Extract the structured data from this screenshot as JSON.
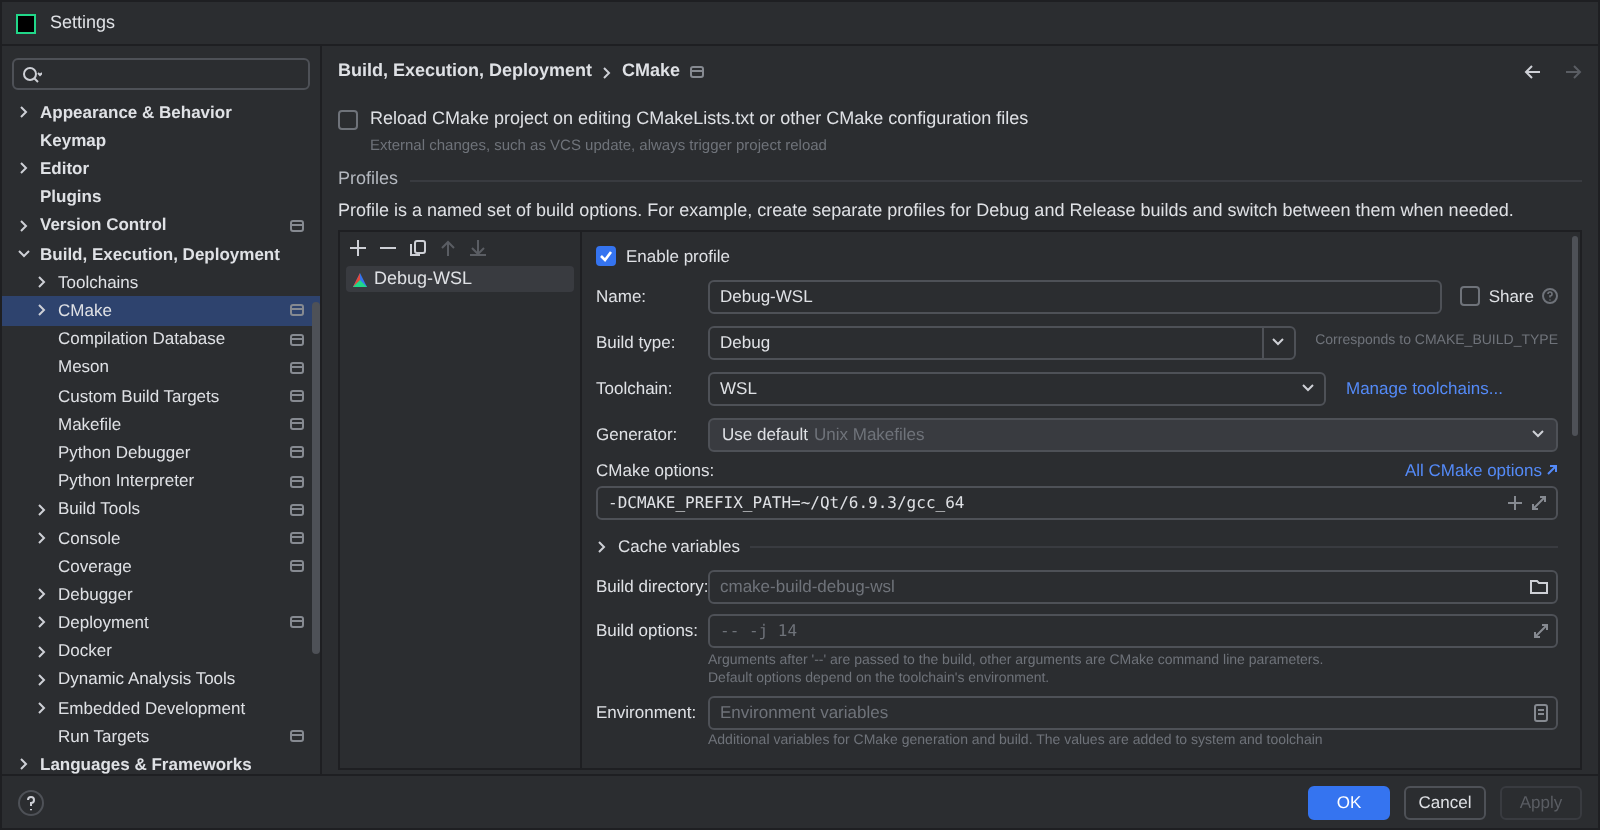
{
  "window": {
    "title": "Settings"
  },
  "sidebar": {
    "items": [
      {
        "label": "Appearance & Behavior",
        "expandable": true,
        "expanded": false,
        "selected": false,
        "project_level": false
      },
      {
        "label": "Keymap",
        "expandable": false,
        "selected": false,
        "project_level": false
      },
      {
        "label": "Editor",
        "expandable": true,
        "expanded": false,
        "selected": false,
        "project_level": false
      },
      {
        "label": "Plugins",
        "expandable": false,
        "selected": false,
        "project_level": false
      },
      {
        "label": "Version Control",
        "expandable": true,
        "expanded": false,
        "selected": false,
        "project_level": true
      },
      {
        "label": "Build, Execution, Deployment",
        "expandable": true,
        "expanded": true,
        "selected": false,
        "project_level": false,
        "children": [
          {
            "label": "Toolchains",
            "expandable": true,
            "expanded": false,
            "selected": false,
            "project_level": false
          },
          {
            "label": "CMake",
            "expandable": true,
            "expanded": false,
            "selected": true,
            "project_level": true
          },
          {
            "label": "Compilation Database",
            "expandable": false,
            "selected": false,
            "project_level": true
          },
          {
            "label": "Meson",
            "expandable": false,
            "selected": false,
            "project_level": true
          },
          {
            "label": "Custom Build Targets",
            "expandable": false,
            "selected": false,
            "project_level": true
          },
          {
            "label": "Makefile",
            "expandable": false,
            "selected": false,
            "project_level": true
          },
          {
            "label": "Python Debugger",
            "expandable": false,
            "selected": false,
            "project_level": true
          },
          {
            "label": "Python Interpreter",
            "expandable": false,
            "selected": false,
            "project_level": true
          },
          {
            "label": "Build Tools",
            "expandable": true,
            "expanded": false,
            "selected": false,
            "project_level": true
          },
          {
            "label": "Console",
            "expandable": true,
            "expanded": false,
            "selected": false,
            "project_level": true
          },
          {
            "label": "Coverage",
            "expandable": false,
            "selected": false,
            "project_level": true
          },
          {
            "label": "Debugger",
            "expandable": true,
            "expanded": false,
            "selected": false,
            "project_level": false
          },
          {
            "label": "Deployment",
            "expandable": true,
            "expanded": false,
            "selected": false,
            "project_level": true
          },
          {
            "label": "Docker",
            "expandable": true,
            "expanded": false,
            "selected": false,
            "project_level": false
          },
          {
            "label": "Dynamic Analysis Tools",
            "expandable": true,
            "expanded": false,
            "selected": false,
            "project_level": false
          },
          {
            "label": "Embedded Development",
            "expandable": true,
            "expanded": false,
            "selected": false,
            "project_level": false
          },
          {
            "label": "Run Targets",
            "expandable": false,
            "selected": false,
            "project_level": true
          }
        ]
      },
      {
        "label": "Languages & Frameworks",
        "expandable": true,
        "expanded": false,
        "selected": false,
        "project_level": false
      }
    ]
  },
  "breadcrumb": [
    "Build, Execution, Deployment",
    "CMake"
  ],
  "reload_option": {
    "label": "Reload CMake project on editing CMakeLists.txt or other CMake configuration files",
    "checked": false,
    "hint": "External changes, such as VCS update, always trigger project reload"
  },
  "profiles": {
    "heading": "Profiles",
    "description": "Profile is a named set of build options. For example, create separate profiles for Debug and Release builds and switch between them when needed.",
    "list": [
      {
        "name": "Debug-WSL",
        "selected": true
      }
    ],
    "enable_profile": {
      "label": "Enable profile",
      "checked": true
    },
    "name": {
      "label": "Name:",
      "value": "Debug-WSL"
    },
    "share": {
      "label": "Share",
      "checked": false
    },
    "build_type": {
      "label": "Build type:",
      "value": "Debug",
      "note": "Corresponds to CMAKE_BUILD_TYPE"
    },
    "toolchain": {
      "label": "Toolchain:",
      "value": "WSL",
      "link": "Manage toolchains..."
    },
    "generator": {
      "label": "Generator:",
      "value": "Use default",
      "hint": "Unix Makefiles"
    },
    "cmake_options": {
      "label": "CMake options:",
      "link": "All CMake options",
      "value": "-DCMAKE_PREFIX_PATH=~/Qt/6.9.3/gcc_64"
    },
    "cache_variables": {
      "label": "Cache variables",
      "expanded": false
    },
    "build_directory": {
      "label": "Build directory:",
      "placeholder": "cmake-build-debug-wsl"
    },
    "build_options": {
      "label": "Build options:",
      "placeholder": "-- -j 14",
      "help": [
        "Arguments after '--' are passed to the build, other arguments are CMake command line parameters.",
        "Default options depend on the toolchain's environment."
      ]
    },
    "environment": {
      "label": "Environment:",
      "placeholder": "Environment variables",
      "help": "Additional variables for CMake generation and build. The values are added to system and toolchain"
    }
  },
  "buttons": [
    {
      "label": "OK",
      "kind": "primary"
    },
    {
      "label": "Cancel",
      "kind": "normal"
    },
    {
      "label": "Apply",
      "kind": "disabled"
    }
  ]
}
